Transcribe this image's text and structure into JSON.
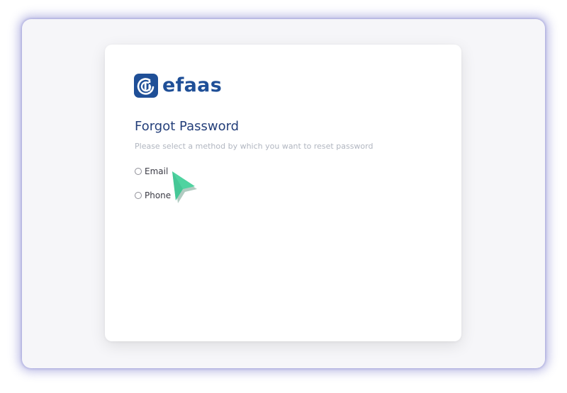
{
  "brand": {
    "name": "efaas",
    "icon": "efaas-logo-icon",
    "color": "#1f4f97"
  },
  "page": {
    "title": "Forgot Password",
    "subtitle": "Please select a method by which you want to reset password"
  },
  "reset_options": [
    {
      "label": "Email",
      "selected": false
    },
    {
      "label": "Phone",
      "selected": false
    }
  ],
  "colors": {
    "frame_glow": "#6e6ec8",
    "title": "#243f7a",
    "subtitle": "#b1b6c0",
    "cursor": "#4fd3a0"
  },
  "cursor": {
    "icon": "mouse-pointer-icon"
  }
}
